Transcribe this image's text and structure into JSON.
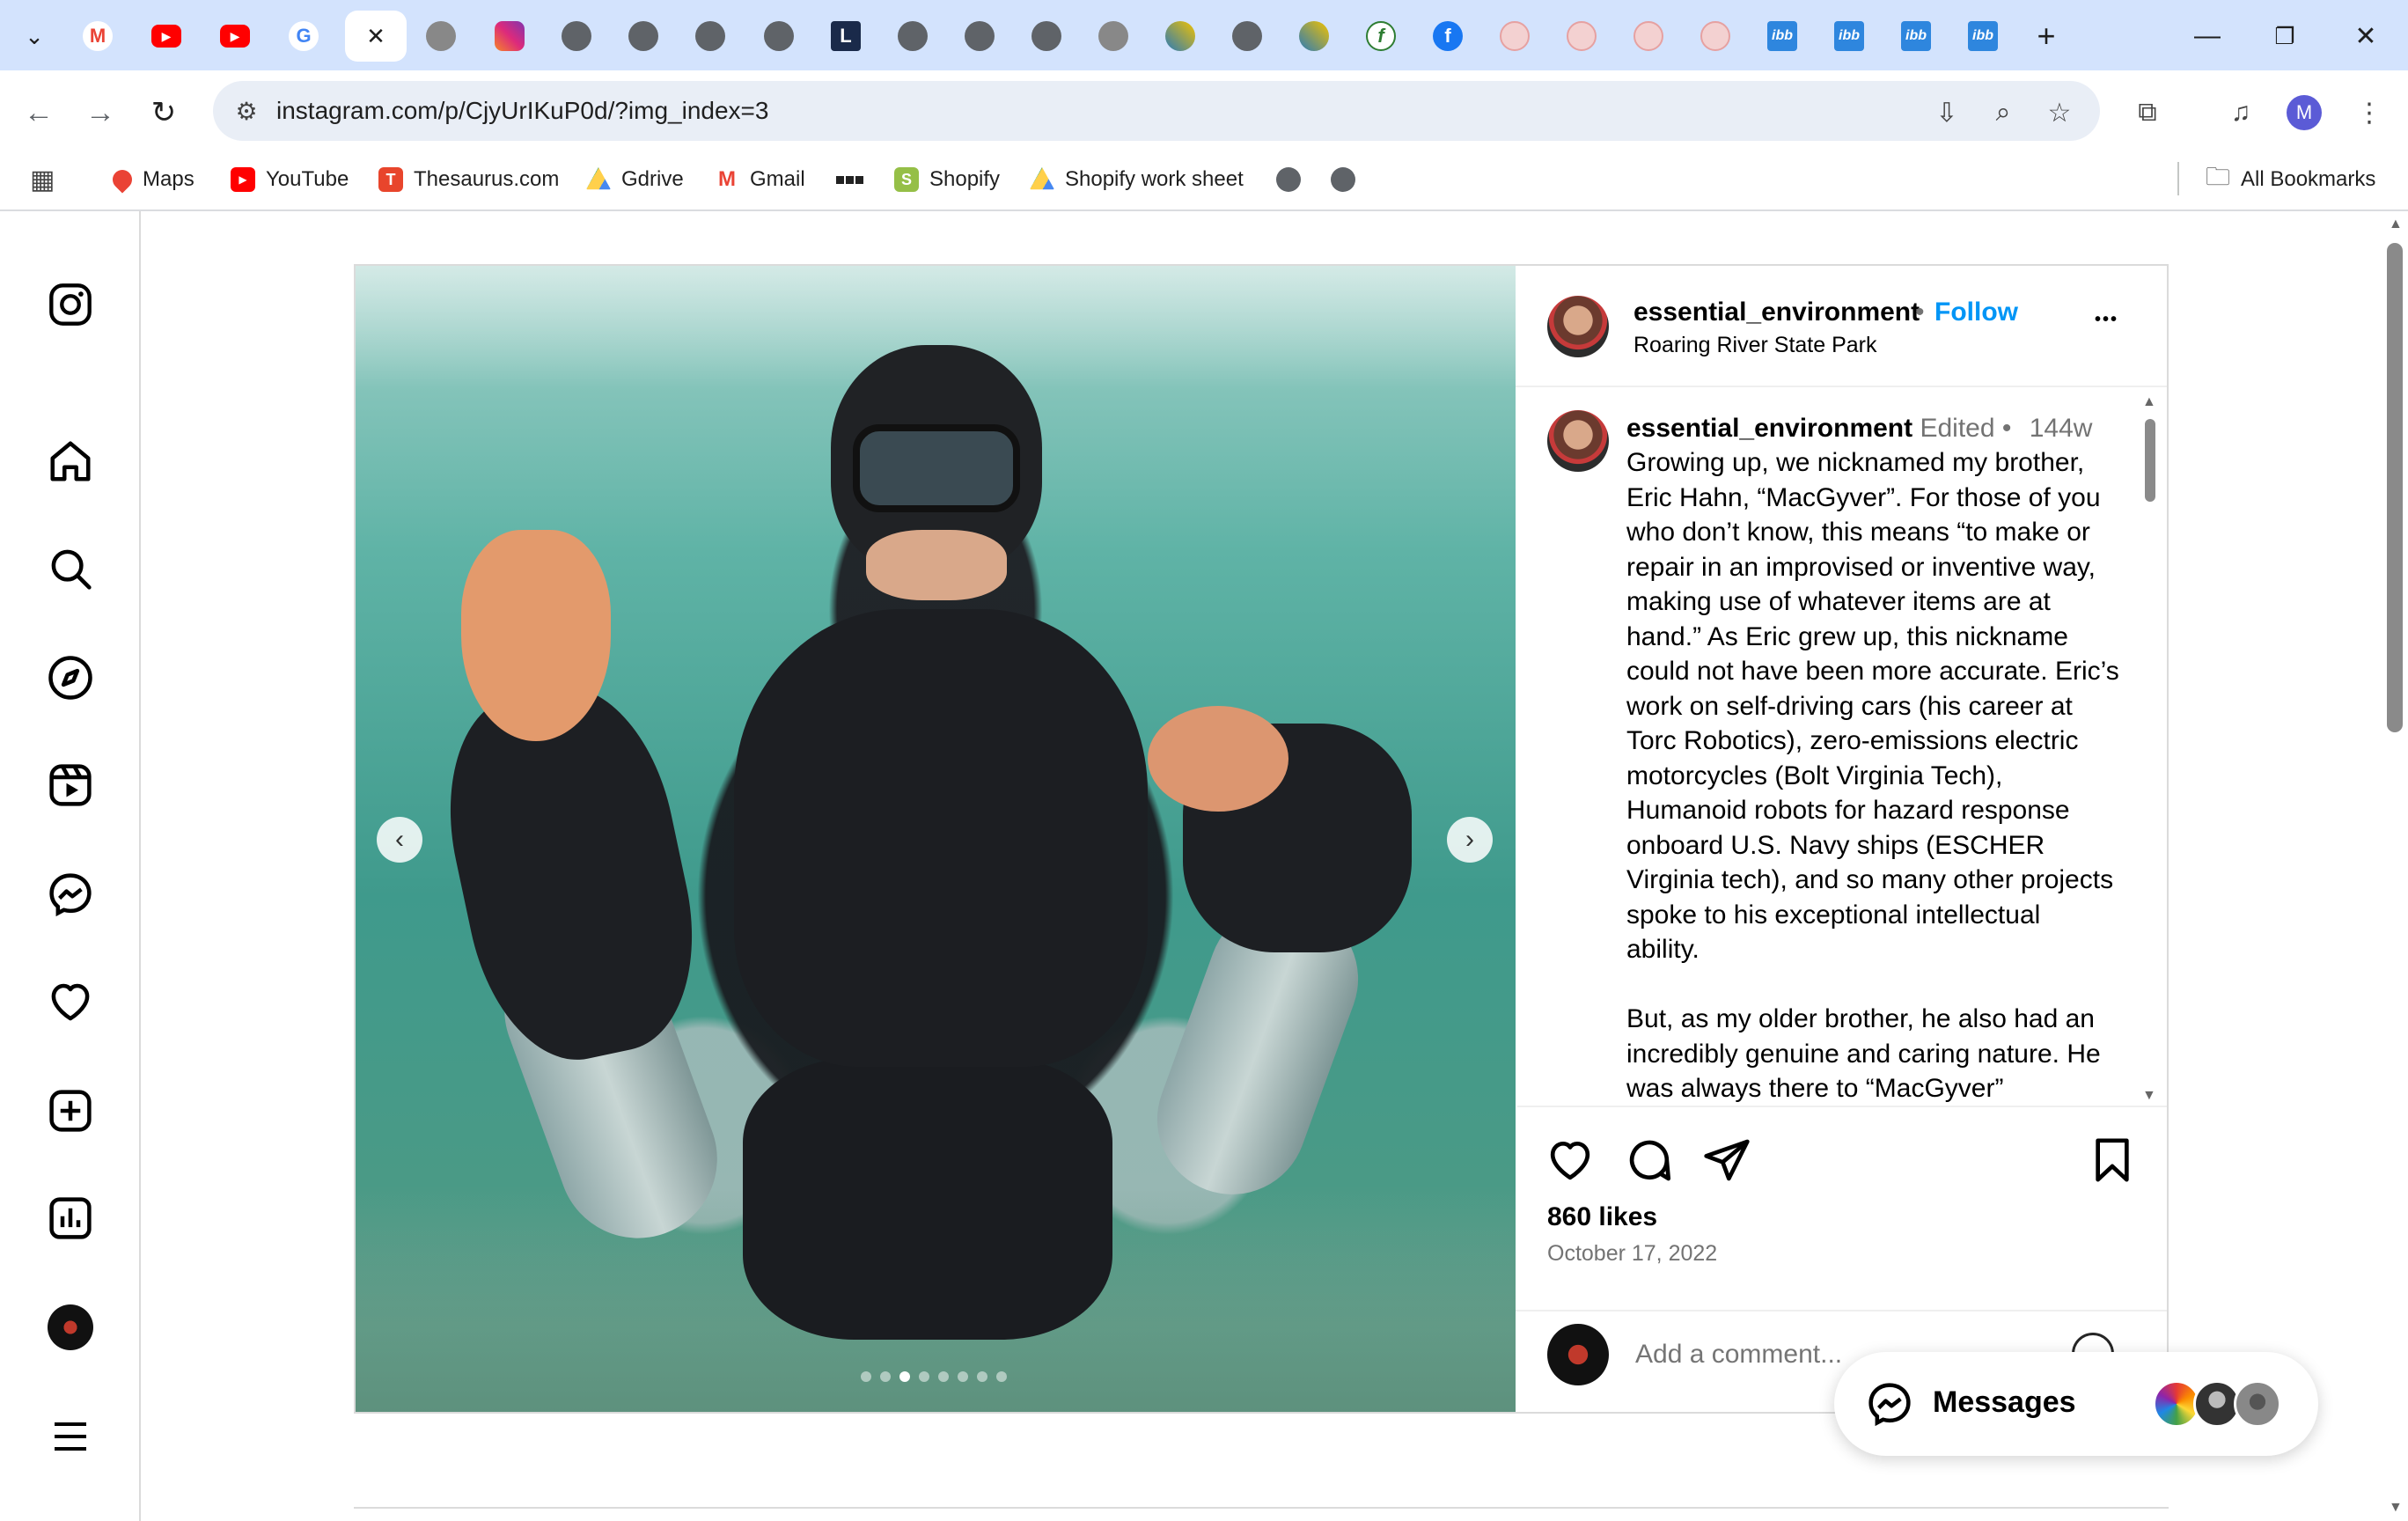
{
  "browser": {
    "url": "instagram.com/p/CjyUrIKuP0d/?img_index=3",
    "profile_initial": "M",
    "tab_list_icon": "chevron-down-icon",
    "active_tab_close": "✕",
    "new_tab": "+"
  },
  "bookmarks": {
    "items": [
      {
        "label": "Maps",
        "icon": "maps-icon",
        "color": "#ea4335"
      },
      {
        "label": "YouTube",
        "icon": "youtube-icon",
        "color": "#ff0000"
      },
      {
        "label": "Thesaurus.com",
        "icon": "thesaurus-icon",
        "color": "#e8452c"
      },
      {
        "label": "Gdrive",
        "icon": "gdrive-icon",
        "color": "#1fa463"
      },
      {
        "label": "Gmail",
        "icon": "gmail-icon",
        "color": "#ea4335"
      },
      {
        "label": "Shopify",
        "icon": "shopify-icon",
        "color": "#95bf47"
      },
      {
        "label": "Shopify work sheet",
        "icon": "gdrive-icon",
        "color": "#1fa463"
      }
    ],
    "all_bookmarks": "All Bookmarks"
  },
  "post": {
    "header": {
      "username": "essential_environment",
      "separator": "•",
      "follow": "Follow",
      "location": "Roaring River State Park",
      "more": "•••"
    },
    "caption": {
      "username": "essential_environment",
      "edited": "Edited",
      "dot": "•",
      "age": "144w",
      "paragraph1": "Growing up, we nicknamed my brother, Eric Hahn, “MacGyver”. For those of you who don’t know, this means “to make or repair in an improvised or inventive way, making use of whatever items are at hand.” As Eric grew up, this nickname could not have been more accurate. Eric’s work on self-driving cars (his career at Torc Robotics), zero-emissions electric motorcycles (Bolt Virginia Tech), Humanoid robots for hazard response onboard U.S. Navy ships (ESCHER Virginia tech), and so many other projects spoke to his exceptional intellectual ability.",
      "paragraph2": "But, as my older brother, he also had an incredibly genuine and caring nature. He was always there to “MacGyver”"
    },
    "likes": "860 likes",
    "date": "October 17, 2022",
    "comment_placeholder": "Add a comment...",
    "carousel": {
      "total": 8,
      "current": 3
    }
  },
  "messages": {
    "label": "Messages"
  },
  "colors": {
    "tabbar": "#d3e3fd",
    "follow_blue": "#0095f6",
    "muted": "#737373"
  }
}
